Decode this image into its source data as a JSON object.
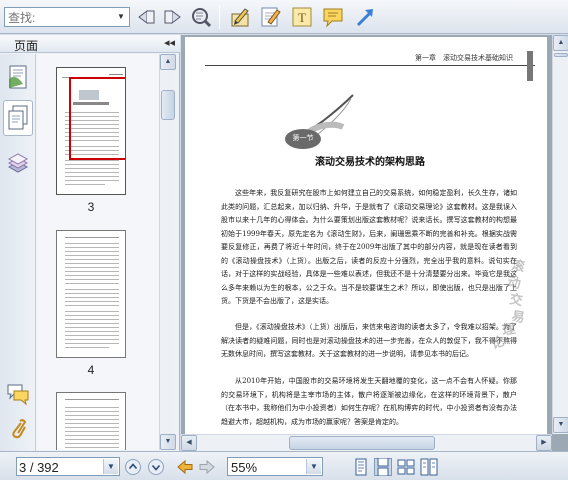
{
  "toolbar": {
    "search_placeholder": "查找:",
    "buttons": [
      "find-previous-icon",
      "find-next-icon",
      "find-options-icon",
      "bookmark-tool-icon",
      "highlight-note-icon",
      "text-tool-icon",
      "comment-icon",
      "arrow-tool-icon"
    ]
  },
  "sidebar": {
    "title": "页面",
    "collapse_glyph": "◂◂",
    "tabs": [
      "thumbnails-icon",
      "pages-icon",
      "layers-icon"
    ],
    "bottom_tabs": [
      "comments-icon",
      "attachments-icon"
    ],
    "thumbnails": [
      {
        "label": "3",
        "selected": true
      },
      {
        "label": "4",
        "selected": false
      },
      {
        "label": "",
        "selected": false
      }
    ]
  },
  "document": {
    "header": "第一章　滚动交易技术基础知识",
    "section_label": "第一节",
    "title": "滚动交易技术的架构思路",
    "paragraphs": [
      "这些年来，我反复研究在股市上如何建立自己的交易系统，如何稳定盈利，长久生存，诸如此类的问题，汇总起来，加以归纳、升华，于是就有了《滚动交易理论》这套教材。这是我误入股市以来十几年的心得体会。为什么要策划出版这套教材呢？说来话长。撰写这套教材的构想最初始于1999年春天，原先定名为《滚动生财》，后来，阑珊思乘不断的完善和补充。根据实战需要反复修正，再费了将近十年时间，终于在2009年出版了其中的部分内容，就是现在读者看到的《滚动操盘技术》（上货）。出版之后，读者的反应十分强烈，完全出乎我的意料。说句实在话，对于这样的实战经验，具体是一些难以表述，但我还不是十分清楚要分出来。毕竟它是我这么多年来赖以为生的根本，公之于众。当不是较要谋生之术？所以，即使出版，也只是出版了上货。下货是不会出版了，这是实话。",
      "但是，《滚动操盘技术》（上货）出版后，来信来电咨询的读者太多了，令我难以招架。为了解决读者的疑难问题，同时也是对滚动操盘技术的进一步完善，在众人的敦促下，我不得不熬得无数休息时间，撰写这套教材。关于这套教材的进一步说明，请参见本书的后记。",
      "从2010年开始，中国股市的交易环境将发生天翻地覆的变化，这一点不会有人怀疑。你那的交易环境下，机构将是主宰市场的主体，散户将逐渐被边缘化，在这样的环境背景下，散户（在本书中，我称他们为中小投资者）如何生存呢？在机构博弈的时代，中小投资者有没有办法趋避大市，超越机构，成为市场的赢家呢？答案是肯定的。"
    ],
    "stamp_text": "滚动交易理论"
  },
  "statusbar": {
    "page_value": "3 / 392",
    "zoom_value": "55%"
  },
  "colors": {
    "toolbar": "#e8edf4",
    "sidebar": "#eef2f7",
    "selection": "#cc0000",
    "doc_background": "#9da8b5"
  }
}
